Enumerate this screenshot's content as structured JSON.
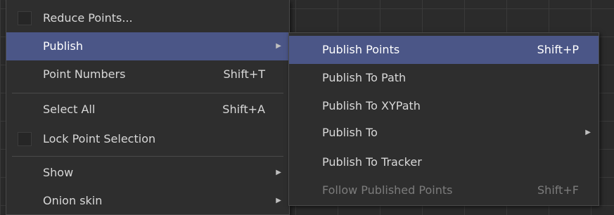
{
  "main_menu": {
    "items": [
      {
        "label": "Reduce Points...",
        "checkbox": true
      },
      {
        "label": "Publish",
        "submenu": true,
        "highlighted": true
      },
      {
        "label": "Point Numbers",
        "shortcut": "Shift+T"
      },
      {
        "label": "Select All",
        "shortcut": "Shift+A"
      },
      {
        "label": "Lock Point Selection",
        "checkbox": true
      },
      {
        "label": "Show",
        "submenu": true
      },
      {
        "label": "Onion skin",
        "submenu": true
      }
    ]
  },
  "publish_submenu": {
    "items": [
      {
        "label": "Publish Points",
        "shortcut": "Shift+P",
        "highlighted": true
      },
      {
        "label": "Publish To Path"
      },
      {
        "label": "Publish To XYPath"
      },
      {
        "label": "Publish To",
        "submenu": true
      },
      {
        "label": "Publish To Tracker"
      },
      {
        "label": "Follow Published Points",
        "shortcut": "Shift+F",
        "disabled": true
      }
    ]
  },
  "icons": {
    "submenu_arrow": "▶"
  },
  "colors": {
    "menu_background": "#2e2e2e",
    "highlight": "#4b5687",
    "text": "#d8d8d8",
    "disabled_text": "#7c7c7c"
  }
}
